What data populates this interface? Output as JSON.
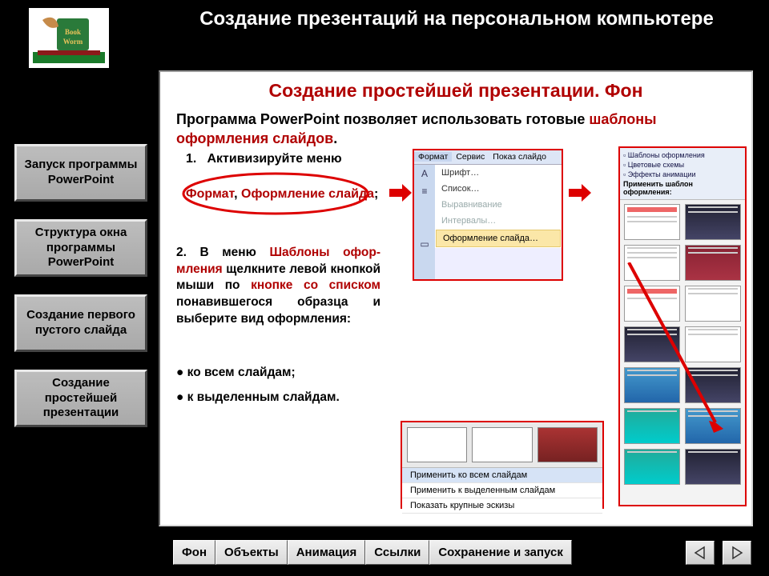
{
  "header": {
    "title": "Создание презентаций на персональном компьютере"
  },
  "sidebar": {
    "items": [
      {
        "label": "Запуск программы PowerPoint"
      },
      {
        "label": "Структура окна программы PowerPoint"
      },
      {
        "label": "Создание первого пустого слайда"
      },
      {
        "label": "Создание простейшей презентации"
      }
    ]
  },
  "content": {
    "section_title": "Создание простейшей презентации. Фон",
    "intro_pre": "Программа PowerPoint позволяет использовать готовые ",
    "intro_hl": "шаблоны оформления слайдов",
    "intro_post": ".",
    "step1_num": "1.",
    "step1_text": "Активизируйте меню",
    "step1_fmt": "Формат",
    "step1_sep": ", ",
    "step1_design": "Оформление слайда",
    "step1_semi": ";",
    "step2_pre": "2. В меню ",
    "step2_hl1": "Шаблоны офор-мления",
    "step2_mid1": " щелкните левой кнопкой мыши по ",
    "step2_hl2": "кнопке со списком",
    "step2_mid2": " понавившегося образца и выберите вид оформления:",
    "bullet1": "● ко всем слайдам;",
    "bullet2": "● к выделенным слайдам.",
    "format_menu": {
      "tabs": [
        "Формат",
        "Сервис",
        "Показ слайдо"
      ],
      "items": [
        {
          "label": "Шрифт…",
          "dim": false
        },
        {
          "label": "Список…",
          "dim": false
        },
        {
          "label": "Выравнивание",
          "dim": true
        },
        {
          "label": "Интервалы…",
          "dim": true
        },
        {
          "label": "Оформление слайда…",
          "hi": true
        }
      ]
    },
    "template_pane": {
      "h1": "Шаблоны оформления",
      "h2": "Цветовые схемы",
      "h3": "Эффекты анимации",
      "apply": "Применить шаблон оформления:"
    },
    "submenu": {
      "items": [
        "Применить ко всем слайдам",
        "Применить к выделенным слайдам",
        "Показать крупные эскизы"
      ]
    }
  },
  "tabs": [
    "Фон",
    "Объекты",
    "Анимация",
    "Ссылки",
    "Сохранение и запуск"
  ]
}
